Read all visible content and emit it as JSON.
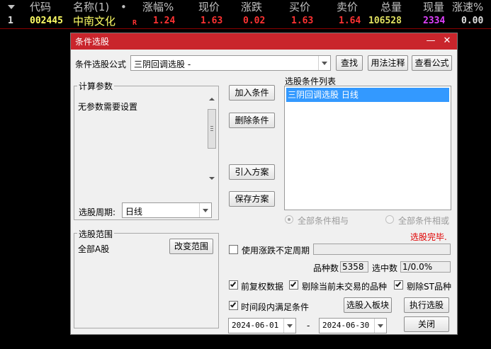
{
  "quote": {
    "headers": {
      "index": "",
      "code": "代码",
      "name": "名称(1)",
      "dot": "•",
      "change_pct": "涨幅%",
      "price": "现价",
      "change": "涨跌",
      "bid": "买价",
      "ask": "卖价",
      "volume": "总量",
      "cur_vol": "现量",
      "speed": "涨速%"
    },
    "row": {
      "index": "1",
      "code": "002445",
      "name": "中南文化",
      "flag": "R",
      "change_pct": "1.24",
      "price": "1.63",
      "change": "0.02",
      "bid": "1.63",
      "ask": "1.64",
      "volume": "106528",
      "cur_vol": "2334",
      "speed": "0.00"
    },
    "colors": {
      "code": "#ffff66",
      "name": "#ffff66",
      "up": "#ff3232",
      "volume": "#e0e060",
      "cur_vol": "#e040ff",
      "neutral": "#e0e0e0"
    }
  },
  "dialog": {
    "title": "条件选股",
    "formula_label": "条件选股公式",
    "formula_value": "三阴回调选股  -",
    "find_button": "查找",
    "usage_button": "用法注释",
    "view_formula_button": "查看公式",
    "params_group_title": "计算参数",
    "params_text": "无参数需要设置",
    "period_label": "选股周期:",
    "period_value": "日线",
    "add_button": "加入条件",
    "delete_button": "删除条件",
    "import_button": "引入方案",
    "save_button": "保存方案",
    "conditions_label": "选股条件列表",
    "conditions": [
      "三阴回调选股  日线"
    ],
    "radio_and": "全部条件相与",
    "radio_or": "全部条件相或",
    "status_text": "选股完毕.",
    "scope_group_title": "选股范围",
    "scope_value": "全部A股",
    "change_scope_button": "改变范围",
    "use_uncertain_label": "使用涨跌不定周期",
    "count_label": "品种数",
    "count_value": "5358",
    "selected_label": "选中数",
    "selected_value": "1/0.0%",
    "adjust_label": "前复权数据",
    "remove_untraded_label": "剔除当前未交易的品种",
    "remove_st_label": "剔除ST品种",
    "time_range_label": "时间段内满足条件",
    "to_block_button": "选股入板块",
    "execute_button": "执行选股",
    "date_from": "2024-06-01",
    "date_sep": "-",
    "date_to": "2024-06-30",
    "close_button": "关闭",
    "minimize_glyph": "—",
    "close_glyph": "✕",
    "colors": {
      "titlebar": "#c9252c",
      "selection": "#3399ff",
      "status": "#e00000"
    }
  }
}
